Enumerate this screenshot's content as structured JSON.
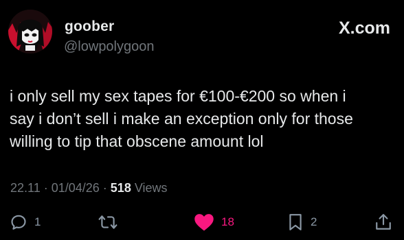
{
  "author": {
    "display_name": "goober",
    "handle": "@lowpolygoon",
    "avatar_icon": "gothic-girl-avatar"
  },
  "brand": {
    "label": "X.com"
  },
  "tweet": {
    "text": "i only sell my sex tapes for €100-€200 so when i\nsay i don’t sell i make an exception only for those\nwilling to tip that obscene amount lol"
  },
  "meta": {
    "time": "22.11",
    "separator": " · ",
    "date": "01/04/26",
    "views_count": "518",
    "views_label": " Views"
  },
  "actions": {
    "reply": {
      "icon": "reply-icon",
      "count": "1"
    },
    "repost": {
      "icon": "repost-icon",
      "count": ""
    },
    "like": {
      "icon": "heart-icon",
      "count": "18",
      "active": true
    },
    "bookmark": {
      "icon": "bookmark-icon",
      "count": "2"
    },
    "share": {
      "icon": "share-icon",
      "count": ""
    }
  },
  "colors": {
    "background": "#000000",
    "text": "#e7e9ea",
    "muted": "#71767b",
    "like_accent": "#f91880"
  }
}
